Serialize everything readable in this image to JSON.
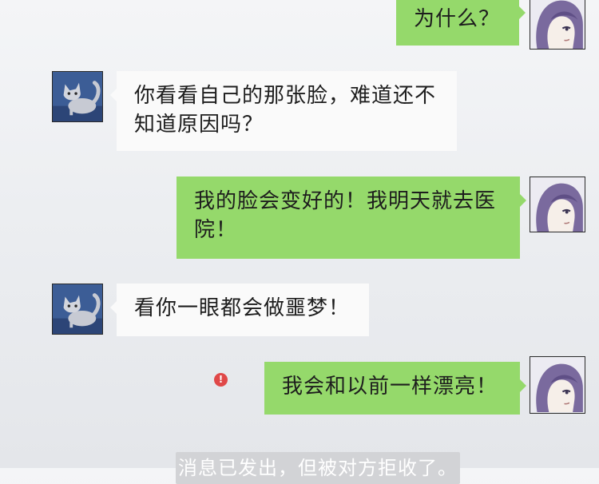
{
  "chat": {
    "messages": [
      {
        "sender": "girl",
        "side": "right",
        "text": "为什么？"
      },
      {
        "sender": "cat",
        "side": "left",
        "text": "你看看自己的那张脸，难道还不知道原因吗？"
      },
      {
        "sender": "girl",
        "side": "right",
        "text": "我的脸会变好的！我明天就去医院！"
      },
      {
        "sender": "cat",
        "side": "left",
        "text": "看你一眼都会做噩梦！"
      },
      {
        "sender": "girl",
        "side": "right",
        "text": "我会和以前一样漂亮！",
        "status": "failed"
      }
    ],
    "error_icon": "!",
    "system_notice": "消息已发出，但被对方拒收了。"
  },
  "avatars": {
    "cat": {
      "icon": "gray-cat-avatar",
      "bg": "#3c5d96"
    },
    "girl": {
      "icon": "purple-hair-girl-avatar",
      "bg": "#e9e7ef"
    }
  },
  "colors": {
    "incoming_bubble": "#fafafa",
    "outgoing_bubble": "#95d96b",
    "error": "#e04848"
  }
}
